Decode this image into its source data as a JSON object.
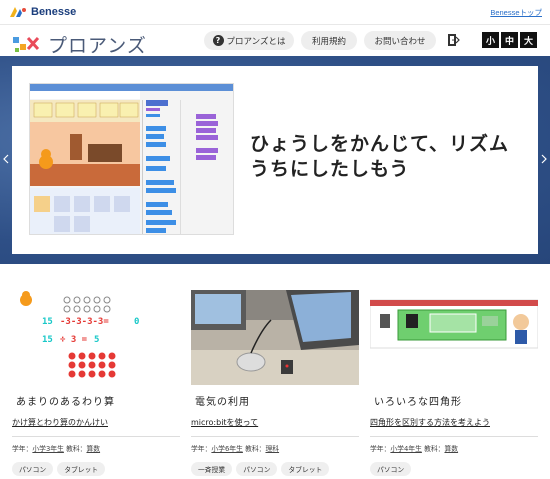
{
  "topbar": {
    "brand": "Benesse",
    "top_link": "Benesseトップ"
  },
  "header": {
    "site_title": "プロアンズ",
    "nav": [
      {
        "label": "プロアンズとは",
        "icon": "question-icon"
      },
      {
        "label": "利用規約"
      },
      {
        "label": "お問い合わせ"
      }
    ],
    "font_sizes": [
      "小",
      "中",
      "大"
    ]
  },
  "hero": {
    "headline_line1": "ひょうしをかんじて、リズム",
    "headline_line2": "うちにしたしもう"
  },
  "cards": [
    {
      "title": "あまりのあるわり算",
      "link": "かけ算とわり算のかんけい",
      "grade_label": "学年：",
      "grade": "小学3年生",
      "subject_label": "教科：",
      "subject": "算数",
      "tags": [
        "パソコン",
        "タブレット"
      ]
    },
    {
      "title": "電気の利用",
      "link": "micro:bitを使って",
      "grade_label": "学年：",
      "grade": "小学6年生",
      "subject_label": "教科：",
      "subject": "理科",
      "tags": [
        "一斉授業",
        "パソコン",
        "タブレット"
      ]
    },
    {
      "title": "いろいろな四角形",
      "link": "四角形を区別する方法を考えよう",
      "grade_label": "学年：",
      "grade": "小学4年生",
      "subject_label": "教科：",
      "subject": "算数",
      "tags": [
        "パソコン"
      ]
    }
  ],
  "colors": {
    "hero_bg": "#3a5d95",
    "link_blue": "#2a6fc9",
    "logo_text": "#4a5a78"
  }
}
